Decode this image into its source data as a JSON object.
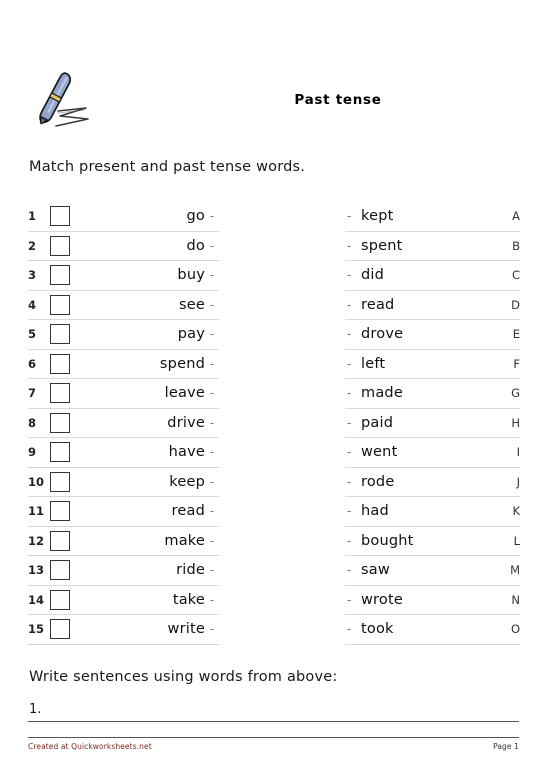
{
  "header": {
    "title": "Past tense",
    "icon": "pen-writing-icon",
    "pen_body_color": "#8fa3c8",
    "pen_band_color": "#e8c65a",
    "pen_outline_color": "#1a1a1a"
  },
  "instruction": "Match present and past tense words.",
  "match": {
    "left_items": [
      {
        "num": "1",
        "word": "go"
      },
      {
        "num": "2",
        "word": "do"
      },
      {
        "num": "3",
        "word": "buy"
      },
      {
        "num": "4",
        "word": "see"
      },
      {
        "num": "5",
        "word": "pay"
      },
      {
        "num": "6",
        "word": "spend"
      },
      {
        "num": "7",
        "word": "leave"
      },
      {
        "num": "8",
        "word": "drive"
      },
      {
        "num": "9",
        "word": "have"
      },
      {
        "num": "10",
        "word": "keep"
      },
      {
        "num": "11",
        "word": "read"
      },
      {
        "num": "12",
        "word": "make"
      },
      {
        "num": "13",
        "word": "ride"
      },
      {
        "num": "14",
        "word": "take"
      },
      {
        "num": "15",
        "word": "write"
      }
    ],
    "right_items": [
      {
        "letter": "A",
        "word": "kept"
      },
      {
        "letter": "B",
        "word": "spent"
      },
      {
        "letter": "C",
        "word": "did"
      },
      {
        "letter": "D",
        "word": "read"
      },
      {
        "letter": "E",
        "word": "drove"
      },
      {
        "letter": "F",
        "word": "left"
      },
      {
        "letter": "G",
        "word": "made"
      },
      {
        "letter": "H",
        "word": "paid"
      },
      {
        "letter": "I",
        "word": "went"
      },
      {
        "letter": "J",
        "word": "rode"
      },
      {
        "letter": "K",
        "word": "had"
      },
      {
        "letter": "L",
        "word": "bought"
      },
      {
        "letter": "M",
        "word": "saw"
      },
      {
        "letter": "N",
        "word": "wrote"
      },
      {
        "letter": "O",
        "word": "took"
      }
    ],
    "dash": "-"
  },
  "write_section": {
    "prompt": "Write sentences using words from above:",
    "answer_number": "1."
  },
  "footer": {
    "created_at": "Created at Quickworksheets.net",
    "page": "Page 1",
    "created_at_color": "#7a2b1e"
  }
}
